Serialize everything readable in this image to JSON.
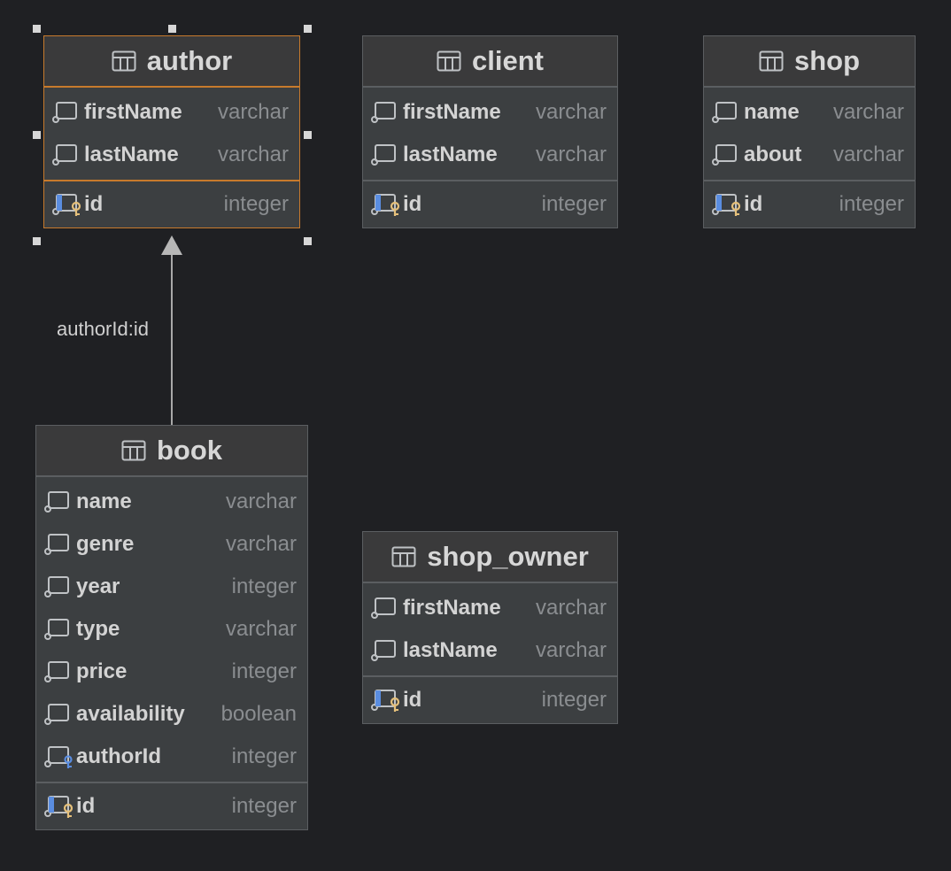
{
  "diagram": {
    "tables": {
      "author": {
        "name": "author",
        "fields": [
          {
            "name": "firstName",
            "type": "varchar"
          },
          {
            "name": "lastName",
            "type": "varchar"
          }
        ],
        "pk": {
          "name": "id",
          "type": "integer"
        }
      },
      "client": {
        "name": "client",
        "fields": [
          {
            "name": "firstName",
            "type": "varchar"
          },
          {
            "name": "lastName",
            "type": "varchar"
          }
        ],
        "pk": {
          "name": "id",
          "type": "integer"
        }
      },
      "shop": {
        "name": "shop",
        "fields": [
          {
            "name": "name",
            "type": "varchar"
          },
          {
            "name": "about",
            "type": "varchar"
          }
        ],
        "pk": {
          "name": "id",
          "type": "integer"
        }
      },
      "book": {
        "name": "book",
        "fields": [
          {
            "name": "name",
            "type": "varchar"
          },
          {
            "name": "genre",
            "type": "varchar"
          },
          {
            "name": "year",
            "type": "integer"
          },
          {
            "name": "type",
            "type": "varchar"
          },
          {
            "name": "price",
            "type": "integer"
          },
          {
            "name": "availability",
            "type": "boolean"
          },
          {
            "name": "authorId",
            "type": "integer",
            "fk": true
          }
        ],
        "pk": {
          "name": "id",
          "type": "integer"
        }
      },
      "shop_owner": {
        "name": "shop_owner",
        "fields": [
          {
            "name": "firstName",
            "type": "varchar"
          },
          {
            "name": "lastName",
            "type": "varchar"
          }
        ],
        "pk": {
          "name": "id",
          "type": "integer"
        }
      }
    },
    "relation": {
      "label": "authorId:id",
      "from": "book",
      "to": "author"
    },
    "selected_table": "author",
    "colors": {
      "background": "#1f2023",
      "table_bg": "#3c3f41",
      "selection": "#c77a2c",
      "key_gold": "#e5c07b",
      "key_blue": "#5a8de0"
    }
  }
}
